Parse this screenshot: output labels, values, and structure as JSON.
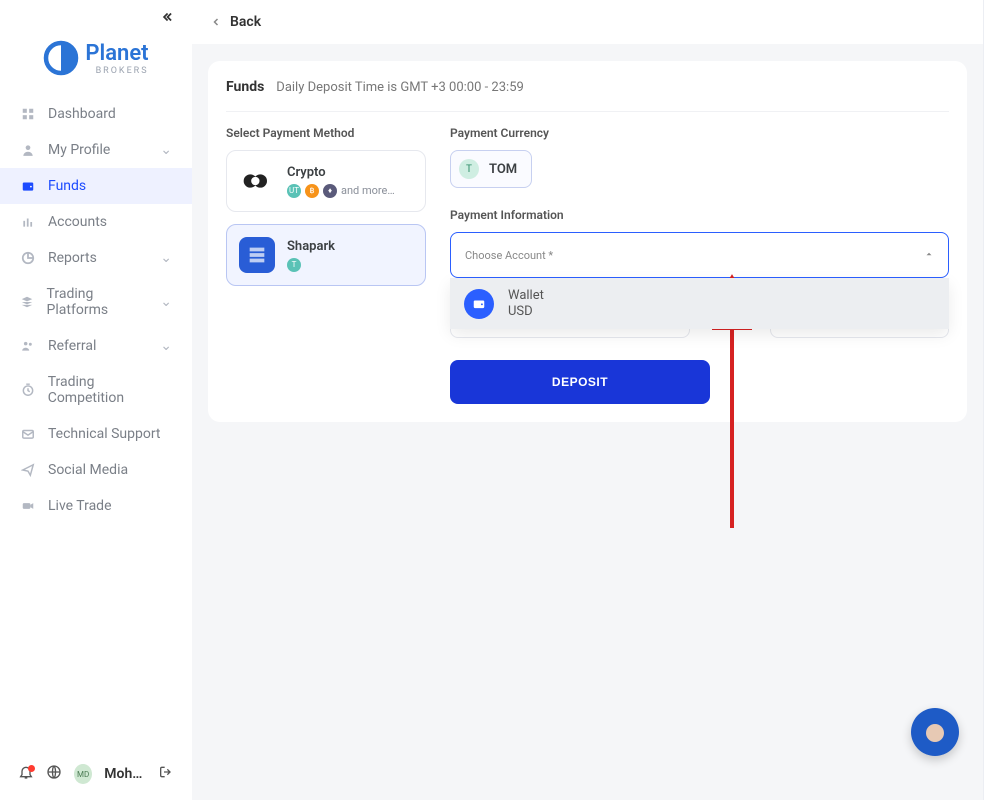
{
  "brand": {
    "name": "Planet",
    "subname": "BROKERS"
  },
  "sidebar": {
    "items": [
      {
        "label": "Dashboard",
        "icon": "dashboard-icon",
        "expandable": false
      },
      {
        "label": "My Profile",
        "icon": "user-icon",
        "expandable": true
      },
      {
        "label": "Funds",
        "icon": "wallet-icon",
        "expandable": false,
        "active": true
      },
      {
        "label": "Accounts",
        "icon": "bars-icon",
        "expandable": false
      },
      {
        "label": "Reports",
        "icon": "chart-icon",
        "expandable": true
      },
      {
        "label": "Trading Platforms",
        "icon": "stack-icon",
        "expandable": true
      },
      {
        "label": "Referral",
        "icon": "users-icon",
        "expandable": true
      },
      {
        "label": "Trading Competition",
        "icon": "clock-icon",
        "expandable": false
      },
      {
        "label": "Technical Support",
        "icon": "mail-icon",
        "expandable": false
      },
      {
        "label": "Social Media",
        "icon": "send-icon",
        "expandable": false
      },
      {
        "label": "Live Trade",
        "icon": "video-icon",
        "expandable": false
      }
    ]
  },
  "bottom": {
    "avatar_initials": "MD",
    "username": "Moha…"
  },
  "topbar": {
    "back_label": "Back"
  },
  "card": {
    "title": "Funds",
    "subtitle": "Daily Deposit Time is GMT +3 00:00 - 23:59"
  },
  "payment_methods": {
    "section_label": "Select Payment Method",
    "options": [
      {
        "name": "Crypto",
        "sub": "and more…",
        "selected": false
      },
      {
        "name": "Shapark",
        "sub": "",
        "selected": true
      }
    ]
  },
  "payment_currency": {
    "section_label": "Payment Currency",
    "selected": {
      "symbol": "T",
      "label": "TOM"
    }
  },
  "payment_information": {
    "section_label": "Payment Information",
    "placeholder": "Choose Account *",
    "dropdown": [
      {
        "title": "Wallet",
        "subtitle": "USD"
      }
    ]
  },
  "deposit_button": "DEPOSIT"
}
